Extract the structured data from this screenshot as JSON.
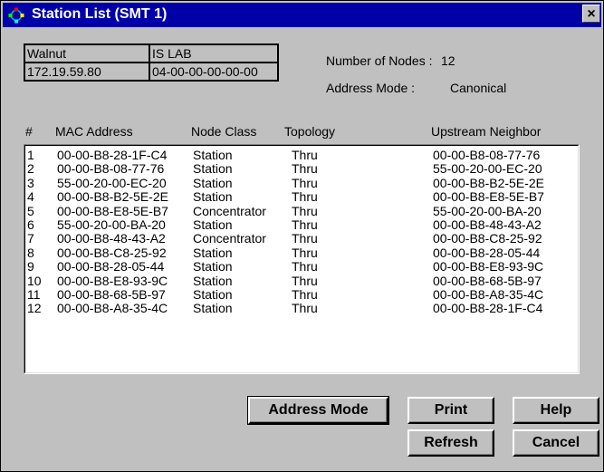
{
  "window": {
    "title": "Station List (SMT 1)",
    "close_label": "×"
  },
  "info": {
    "name": "Walnut",
    "location": "IS LAB",
    "ip": "172.19.59.80",
    "mac": "04-00-00-00-00-00",
    "nodes_label": "Number of Nodes :",
    "nodes_value": "12",
    "address_mode_label": "Address Mode :",
    "address_mode_value": "Canonical"
  },
  "table": {
    "headers": [
      "#",
      "MAC Address",
      "Node Class",
      "Topology",
      "Upstream Neighbor"
    ],
    "rows": [
      [
        "1",
        "00-00-B8-28-1F-C4",
        "Station",
        "Thru",
        "00-00-B8-08-77-76"
      ],
      [
        "2",
        "00-00-B8-08-77-76",
        "Station",
        "Thru",
        "55-00-20-00-EC-20"
      ],
      [
        "3",
        "55-00-20-00-EC-20",
        "Station",
        "Thru",
        "00-00-B8-B2-5E-2E"
      ],
      [
        "4",
        "00-00-B8-B2-5E-2E",
        "Station",
        "Thru",
        "00-00-B8-E8-5E-B7"
      ],
      [
        "5",
        "00-00-B8-E8-5E-B7",
        "Concentrator",
        "Thru",
        "55-00-20-00-BA-20"
      ],
      [
        "6",
        "55-00-20-00-BA-20",
        "Station",
        "Thru",
        "00-00-B8-48-43-A2"
      ],
      [
        "7",
        "00-00-B8-48-43-A2",
        "Concentrator",
        "Thru",
        "00-00-B8-C8-25-92"
      ],
      [
        "8",
        "00-00-B8-C8-25-92",
        "Station",
        "Thru",
        "00-00-B8-28-05-44"
      ],
      [
        "9",
        "00-00-B8-28-05-44",
        "Station",
        "Thru",
        "00-00-B8-E8-93-9C"
      ],
      [
        "10",
        "00-00-B8-E8-93-9C",
        "Station",
        "Thru",
        "00-00-B8-68-5B-97"
      ],
      [
        "11",
        "00-00-B8-68-5B-97",
        "Station",
        "Thru",
        "00-00-B8-A8-35-4C"
      ],
      [
        "12",
        "00-00-B8-A8-35-4C",
        "Station",
        "Thru",
        "00-00-B8-28-1F-C4"
      ]
    ]
  },
  "buttons": {
    "address_mode": "Address Mode",
    "print": "Print",
    "help": "Help",
    "refresh": "Refresh",
    "cancel": "Cancel"
  },
  "colors": {
    "title_bar": "#0000a8",
    "face": "#c0c0c0"
  }
}
